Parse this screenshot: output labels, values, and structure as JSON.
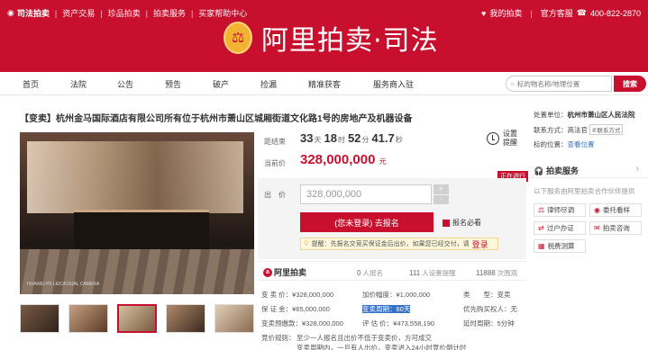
{
  "topbar": {
    "brand": "司法拍卖",
    "links": [
      "资产交易",
      "珍品拍卖",
      "拍卖服务",
      "买家帮助中心"
    ],
    "my_auction": "我的拍卖",
    "service": "官方客服",
    "phone": "400-822-2870"
  },
  "logo": {
    "title": "阿里拍卖·司法"
  },
  "nav": {
    "items": [
      "首页",
      "法院",
      "公告",
      "预告",
      "破产",
      "捡漏",
      "精准获客",
      "服务商入驻"
    ],
    "search_placeholder": "标的物名称/地理位置",
    "search_button": "搜索"
  },
  "lot": {
    "title": "【变卖】杭州金马国际酒店有限公司所有位于杭州市萧山区城厢街道文化路1号的房地产及机器设备",
    "watermark": "HUAWEI P9 LEICA DUAL CAMERA"
  },
  "countdown": {
    "label": "距结束",
    "days": "33",
    "days_unit": "天",
    "hours": "18",
    "hours_unit": "时",
    "minutes": "52",
    "minutes_unit": "分",
    "seconds": "41.7",
    "seconds_unit": "秒"
  },
  "remind": {
    "line1": "设置",
    "line2": "提醒"
  },
  "price": {
    "label": "当前价",
    "value": "328,000,000",
    "unit": "元"
  },
  "status_badge": "正在进行",
  "bid": {
    "label": "出　价",
    "value": "328,000,000",
    "plus": "+",
    "minus": "-",
    "sign_button": "(您未登录) 去报名",
    "must_read": "报名必看",
    "tip_prefix": "提醒：先报名交竞买保证金后出价，如果您已经交付，请",
    "tip_login": "登录"
  },
  "stats": {
    "ali_label": "阿里拍卖",
    "signups": "0",
    "signups_label": "人报名",
    "reminders": "111",
    "reminders_label": "人设置提醒",
    "views": "11888",
    "views_label": "次围观"
  },
  "details": {
    "start_price": "变 卖 价：¥328,000,000",
    "increment": "加价幅度：¥1,000,000",
    "type_label": "类　　型：",
    "type_value": "变卖",
    "deposit": "保 证 金：¥65,000,000",
    "period_hl": "变卖周期：60天",
    "priority": "优先购买权人：无",
    "advance": "变卖预缴款：¥328,000,000",
    "valuation": "评 估 价：¥473,558,190",
    "delay": "延时周期：5分钟",
    "rule_label": "竞价规则：",
    "rule1": "至少一人报名且出价不低于变卖价，方可成交",
    "rule2": "变卖周期内，一旦有人出价，变卖进入24小时竞价倒计时"
  },
  "sidebar": {
    "court_label": "处置单位：",
    "court": "杭州市萧山区人民法院",
    "contact_label": "联系方式：",
    "contact": "高法官",
    "contact_btn": "联系方式",
    "location_label": "标的位置：",
    "location": "查看位置",
    "service_title": "拍卖服务",
    "service_sub": "以下服务由阿里拍卖合作伙伴提供",
    "buttons": [
      "律师尽调",
      "委托看样",
      "过户办证",
      "拍卖咨询",
      "税费测算"
    ]
  }
}
